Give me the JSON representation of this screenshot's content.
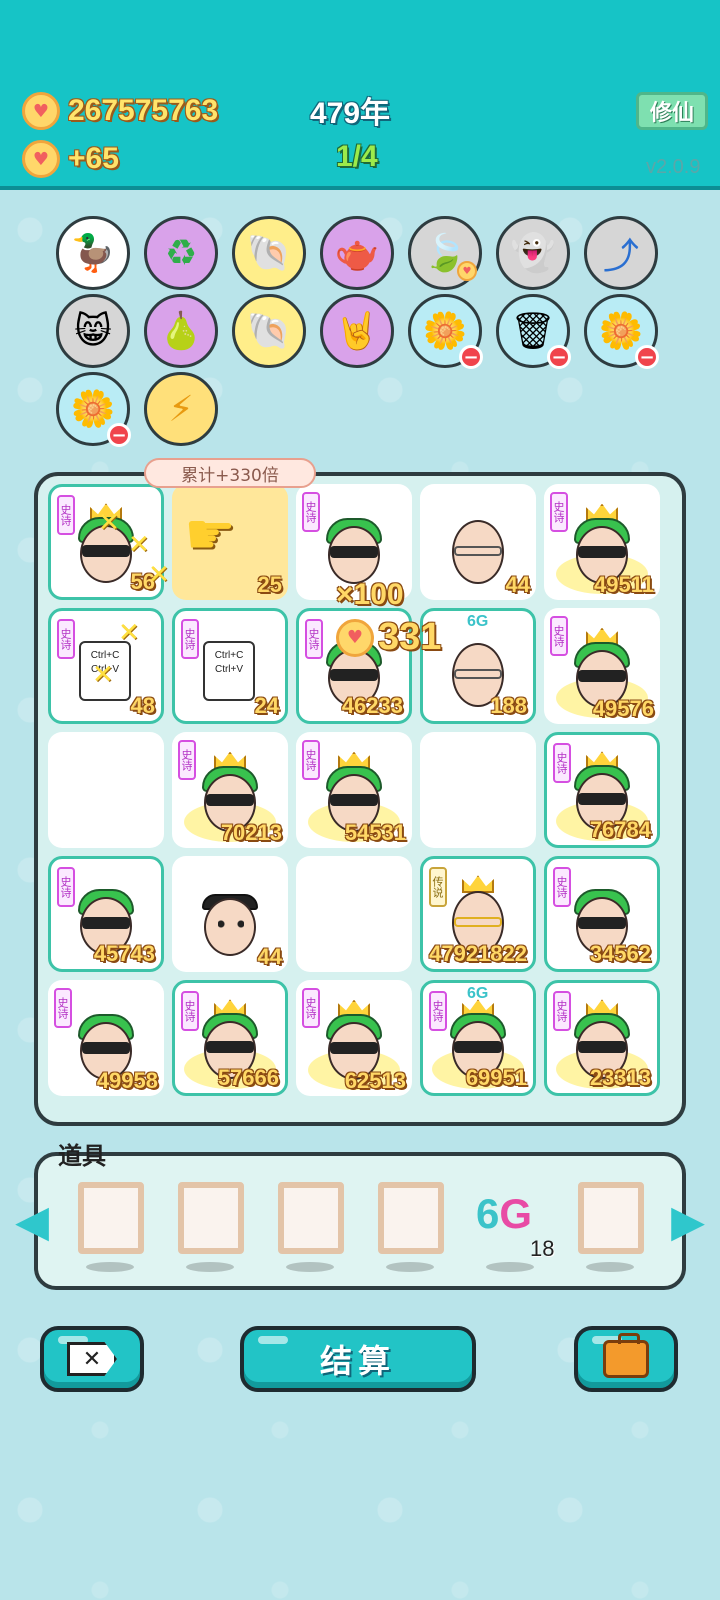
{
  "header": {
    "coins": "267575763",
    "income": "+65",
    "year": "479年",
    "round": "1/4",
    "cultivate_label": "修仙",
    "version": "v2.0.9"
  },
  "relics": [
    {
      "name": "duck-pot-icon",
      "glyph": "🦆"
    },
    {
      "name": "recycle-icon",
      "glyph": "♻"
    },
    {
      "name": "shell-icon",
      "glyph": "🐚"
    },
    {
      "name": "gravy-boat-icon",
      "glyph": "🫖"
    },
    {
      "name": "leaf-icon",
      "glyph": "🍃"
    },
    {
      "name": "ghost-icon",
      "glyph": "👻"
    },
    {
      "name": "arrow-card-icon",
      "glyph": "⤴"
    },
    {
      "name": "cat-face-icon",
      "glyph": "😸"
    },
    {
      "name": "grapefruit-icon",
      "glyph": "🍐"
    },
    {
      "name": "shell-icon",
      "glyph": "🐚"
    },
    {
      "name": "rock-hand-icon",
      "glyph": "🤘"
    },
    {
      "name": "flower-pot-icon",
      "glyph": "🌼"
    },
    {
      "name": "trash-bag-icon",
      "glyph": "🗑"
    },
    {
      "name": "flower-pot-icon",
      "glyph": "🌼"
    },
    {
      "name": "flower-pot-icon",
      "glyph": "🌼"
    },
    {
      "name": "lightning-icon",
      "glyph": "⚡"
    }
  ],
  "tooltip": "累计+330倍",
  "multiplier": "×100",
  "bonus": "331",
  "tags": {
    "epic": "史诗",
    "legend": "传说"
  },
  "sixg": "6G",
  "board": {
    "values": [
      "56",
      "25",
      "",
      "44",
      "49511",
      "48",
      "24",
      "46233",
      "188",
      "49576",
      "",
      "70213",
      "54531",
      "",
      "76784",
      "45743",
      "44",
      "",
      "47921822",
      "34562",
      "49958",
      "57666",
      "62513",
      "69951",
      "23313"
    ]
  },
  "ctrl_card": {
    "line1": "Ctrl+C",
    "line2": "Ctrl+V"
  },
  "items": {
    "label": "道具",
    "sixg_six": "6",
    "sixg_g": "G",
    "sixg_count": "18"
  },
  "buttons": {
    "settle": "结算"
  }
}
